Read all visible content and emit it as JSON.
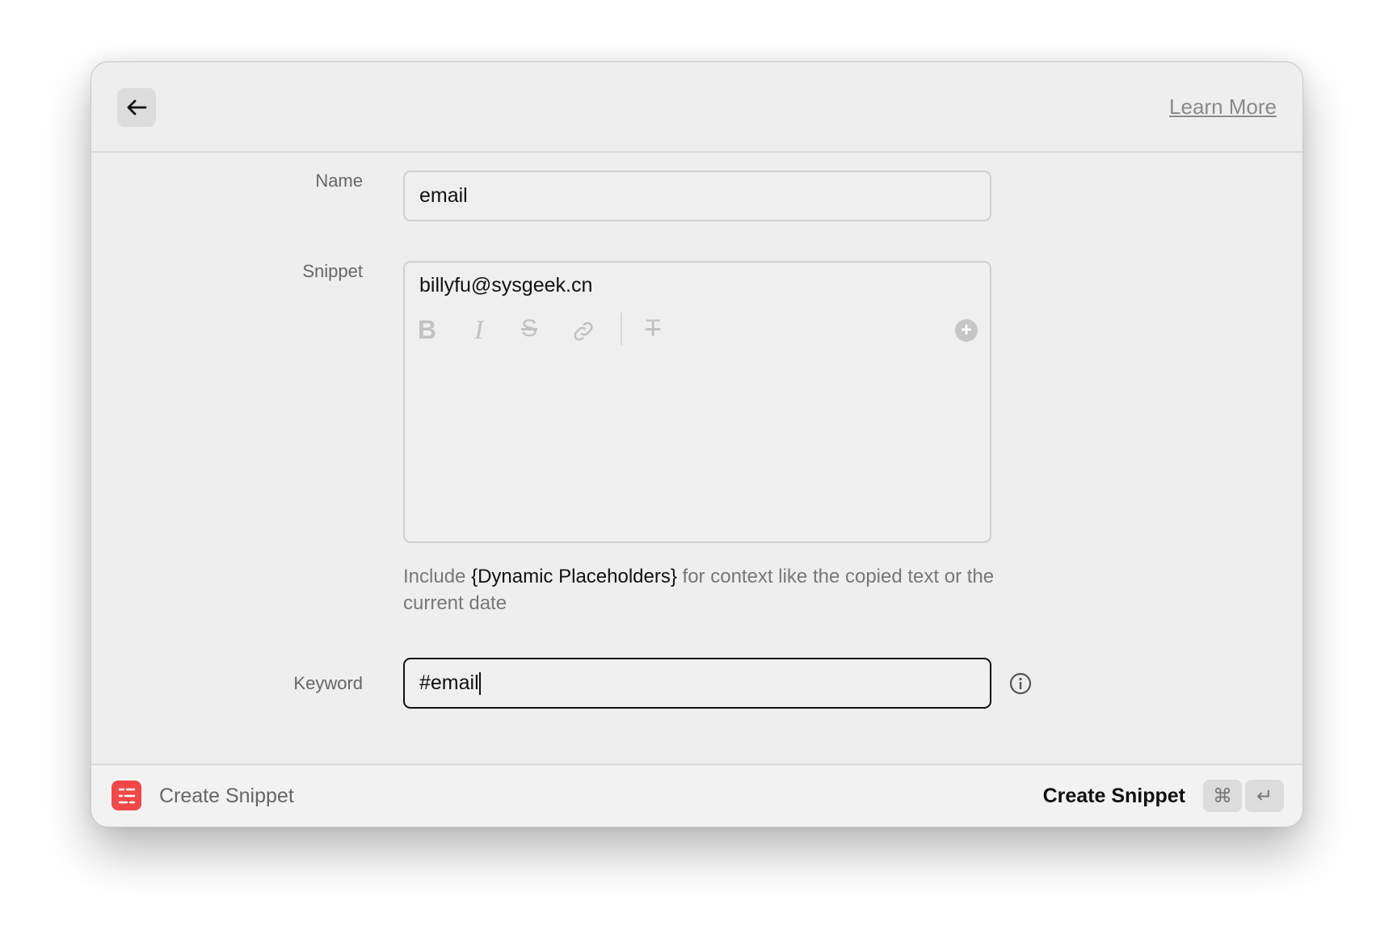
{
  "header": {
    "back_icon": "arrow-left-icon",
    "learn_more": "Learn More"
  },
  "form": {
    "name_label": "Name",
    "name_value": "email",
    "snippet_label": "Snippet",
    "snippet_value": "billyfu@sysgeek.cn",
    "toolbar": [
      "bold-icon",
      "italic-icon",
      "strikethrough-icon",
      "link-icon",
      "clear-format-icon",
      "add-placeholder-icon"
    ],
    "help_prefix": "Include ",
    "help_highlight": "{Dynamic Placeholders}",
    "help_suffix": " for context like the copied text or the current date",
    "keyword_label": "Keyword",
    "keyword_value": "#email"
  },
  "footer": {
    "title": "Create Snippet",
    "action": "Create Snippet",
    "key_cmd": "⌘",
    "key_enter": "↵",
    "app_color": "#f04848"
  }
}
